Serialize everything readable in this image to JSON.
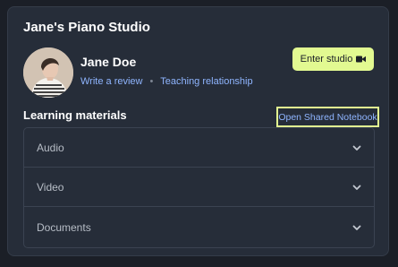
{
  "studio": {
    "title": "Jane's Piano Studio"
  },
  "user": {
    "name": "Jane Doe",
    "links": [
      {
        "label": "Write a review"
      },
      {
        "label": "Teaching relationship"
      }
    ],
    "separator": "•"
  },
  "actions": {
    "enter_studio_label": "Enter studio",
    "enter_studio_icon": "video-camera-icon",
    "open_notebook_label": "Open Shared Notebook"
  },
  "materials": {
    "title": "Learning materials",
    "items": [
      {
        "label": "Audio",
        "expanded": false
      },
      {
        "label": "Video",
        "expanded": false
      },
      {
        "label": "Documents",
        "expanded": false
      }
    ]
  },
  "colors": {
    "page_bg": "#1b1f27",
    "card_bg": "#262d39",
    "accent": "#e2f991",
    "link": "#8fb5ff",
    "text": "#ffffff",
    "muted": "#b7bdc6"
  }
}
